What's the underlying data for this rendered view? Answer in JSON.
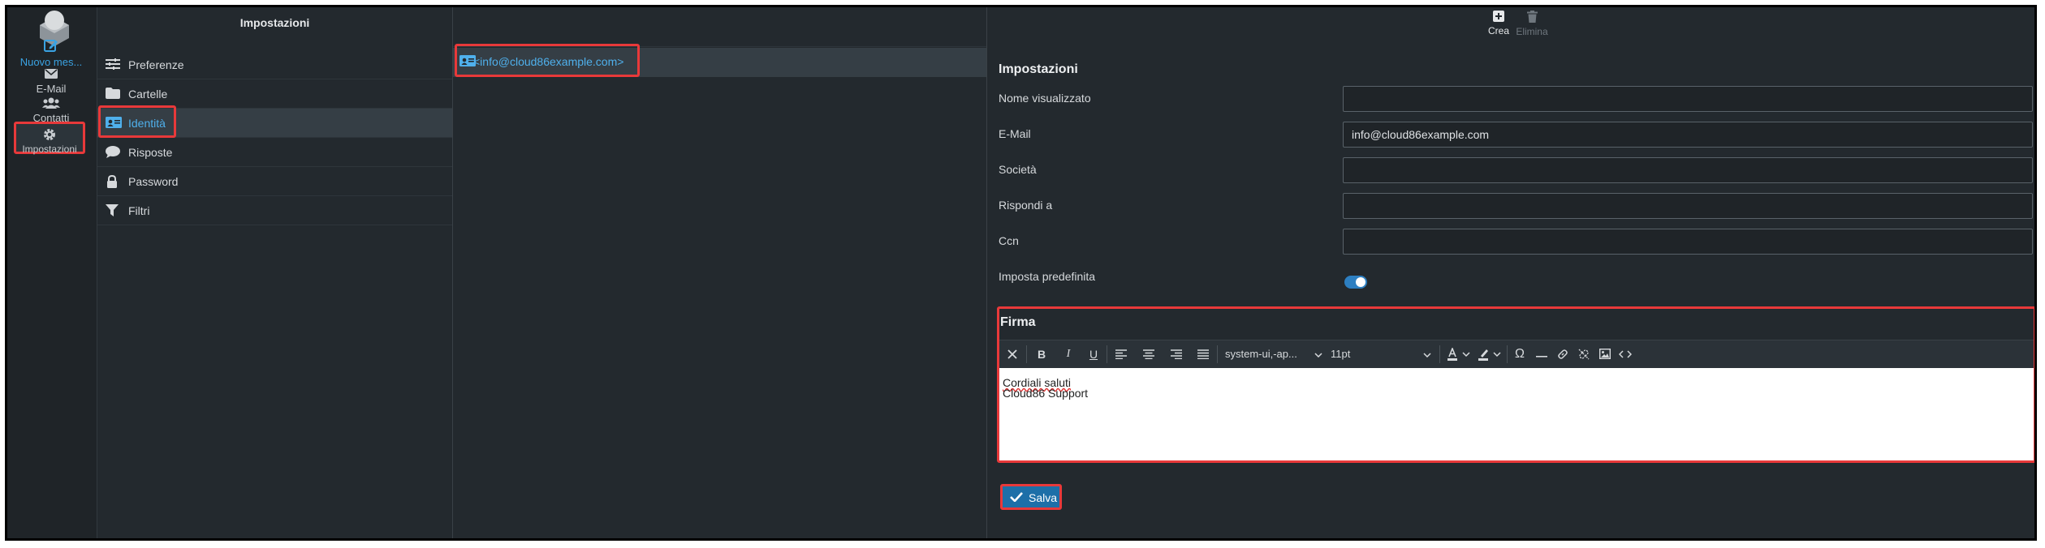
{
  "nav": {
    "items": [
      {
        "label": "Nuovo mes..."
      },
      {
        "label": "E-Mail"
      },
      {
        "label": "Contatti"
      },
      {
        "label": "Impostazioni"
      }
    ]
  },
  "settings": {
    "title": "Impostazioni",
    "items": [
      {
        "label": "Preferenze"
      },
      {
        "label": "Cartelle"
      },
      {
        "label": "Identità"
      },
      {
        "label": "Risposte"
      },
      {
        "label": "Password"
      },
      {
        "label": "Filtri"
      }
    ]
  },
  "identities": {
    "items": [
      {
        "label": "<info@cloud86example.com>"
      }
    ]
  },
  "toolbar": {
    "create_label": "Crea",
    "delete_label": "Elimina"
  },
  "form": {
    "title": "Impostazioni",
    "fields": [
      {
        "label": "Nome visualizzato",
        "value": ""
      },
      {
        "label": "E-Mail",
        "value": "info@cloud86example.com"
      },
      {
        "label": "Società",
        "value": ""
      },
      {
        "label": "Rispondi a",
        "value": ""
      },
      {
        "label": "Ccn",
        "value": ""
      }
    ],
    "default_label": "Imposta predefinita",
    "default_on": true
  },
  "signature": {
    "title": "Firma",
    "font_family": "system-ui,-ap...",
    "font_size": "11pt",
    "lines": [
      "Cordiali saluti",
      "Cloud86 Support"
    ]
  },
  "save_label": "Salva",
  "colors": {
    "accent": "#3aa3e3",
    "highlight": "#e8393a",
    "save": "#1d6fa8"
  }
}
